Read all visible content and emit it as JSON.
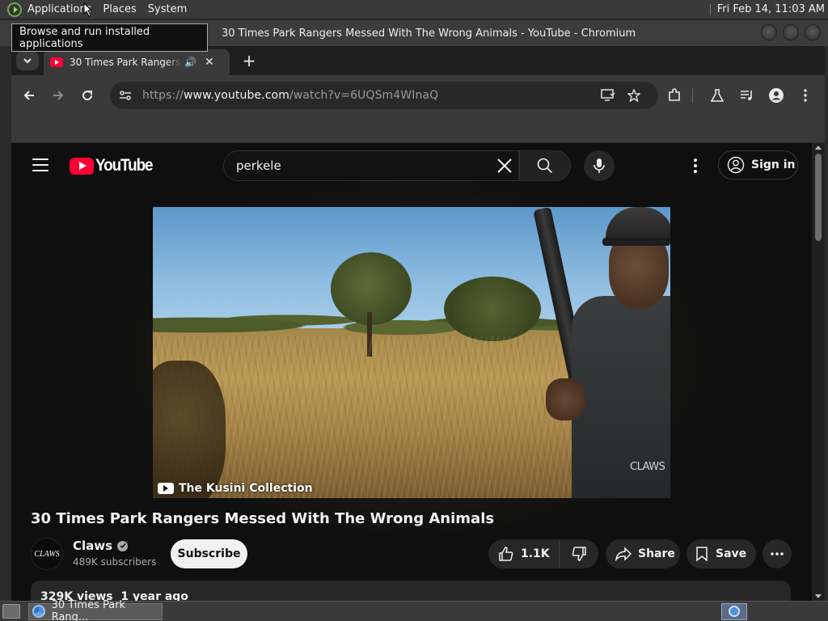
{
  "os_panel": {
    "menus": [
      "Applications",
      "Places",
      "System"
    ],
    "clock": "Fri Feb 14, 11:03 AM"
  },
  "tooltip": "Browse and run installed applications",
  "window": {
    "title": "30 Times Park Rangers Messed With The Wrong Animals - YouTube - Chromium"
  },
  "tabs": [
    {
      "label": "30 Times Park Rangers Messed With The Wrong Animals - YouTube",
      "audio": "playing"
    }
  ],
  "toolbar": {
    "url_prefix": "https://",
    "url_domain": "www.youtube.com",
    "url_path": "/watch?v=6UQSm4WInaQ"
  },
  "youtube": {
    "logo_text": "YouTube",
    "search_query": "perkele",
    "signin_label": "Sign in",
    "video": {
      "caption": "The Kusini Collection",
      "watermark": "CLAWS"
    },
    "title": "30 Times Park Rangers Messed With The Wrong Animals",
    "channel": {
      "name": "Claws",
      "subscribers": "489K subscribers",
      "avatar_text": "CLAWS"
    },
    "subscribe_label": "Subscribe",
    "likes": "1.1K",
    "share_label": "Share",
    "save_label": "Save",
    "description_meta": "329K views  1 year ago"
  },
  "taskbar": {
    "window_label": "30 Times Park Rang..."
  },
  "colors": {
    "yt_red": "#ff0033",
    "page_bg": "#0f0f0f",
    "chip_bg": "#272727"
  }
}
